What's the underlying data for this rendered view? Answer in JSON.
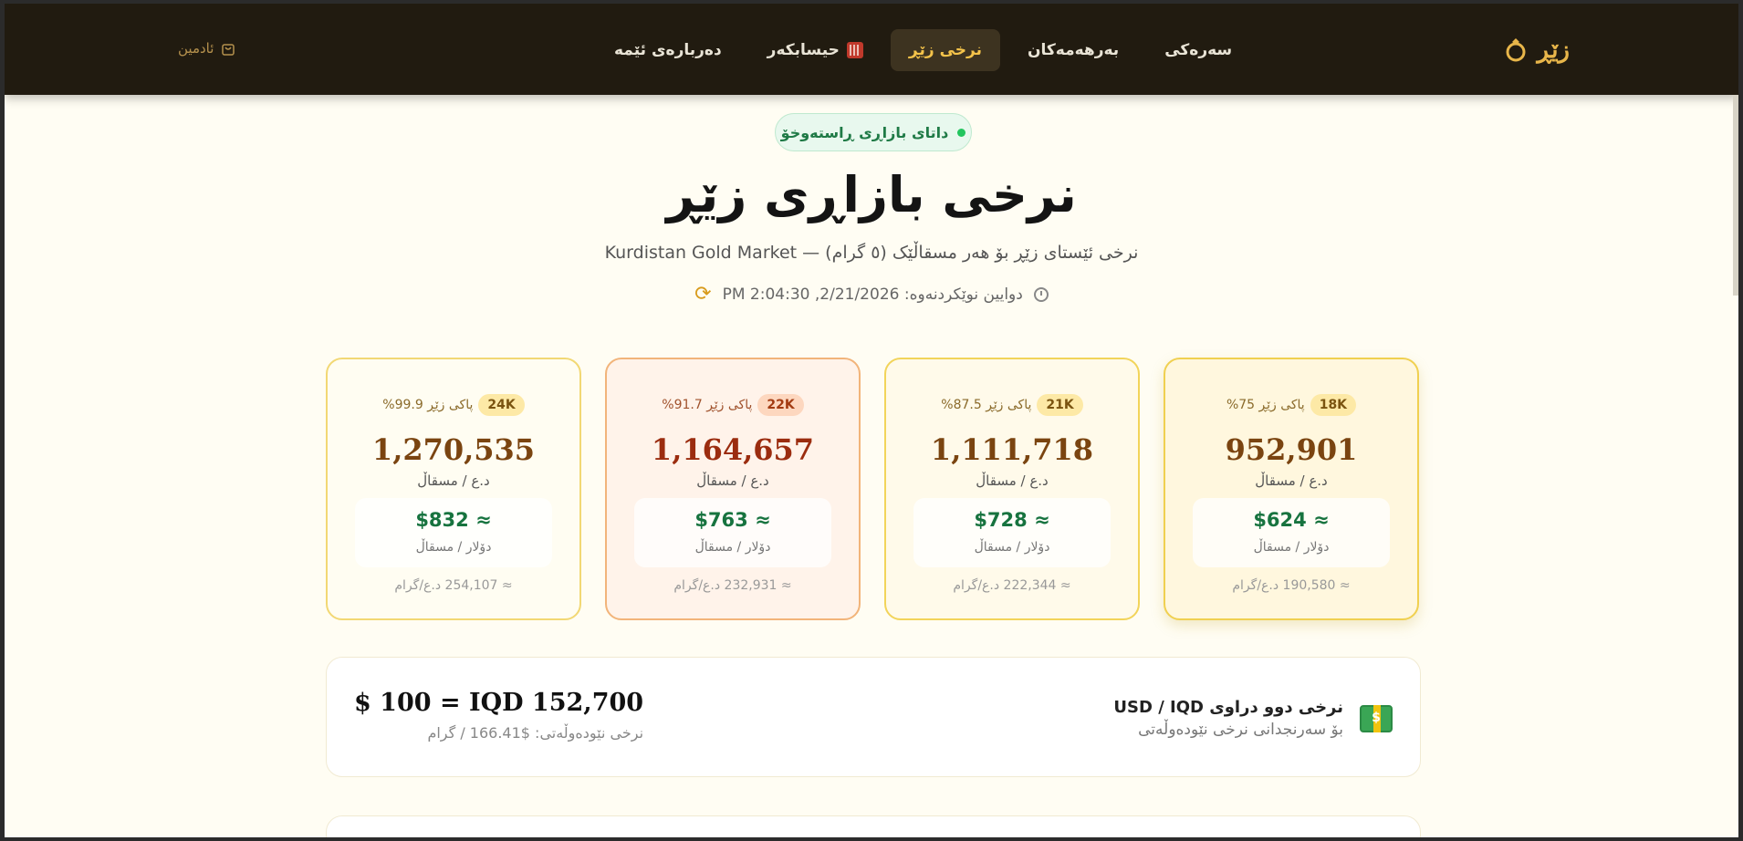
{
  "nav": {
    "brand": "زێڕ",
    "items": [
      {
        "label": "سەرەکی"
      },
      {
        "label": "بەرهەمەکان"
      },
      {
        "label": "نرخی زێڕ"
      },
      {
        "label": "حیسابکەر"
      },
      {
        "label": "دەربارەی ئێمە"
      }
    ],
    "active_index": 2,
    "admin": "ئادمین"
  },
  "hero": {
    "badge": "داتای بازاڕی ڕاستەوخۆ",
    "title": "نرخی بازاڕی زێڕ",
    "subtitle": "نرخی ئێستای زێڕ بۆ هەر مسقاڵێک (٥ گرام) — Kurdistan Gold Market",
    "updated": "دوایین نوێکردنەوە: 2/21/2026, 2:04:30 PM"
  },
  "cards": [
    {
      "karat": "24K",
      "purity": "پاکی زێڕ 99.9%",
      "price": "1,270,535",
      "unit": "د.ع / مسقاڵ",
      "usd": "≈ $832",
      "usd_unit": "دۆلار / مسقاڵ",
      "per_gram": "≈ 254,107 د.ع/گرام"
    },
    {
      "karat": "22K",
      "purity": "پاکی زێڕ 91.7%",
      "price": "1,164,657",
      "unit": "د.ع / مسقاڵ",
      "usd": "≈ $763",
      "usd_unit": "دۆلار / مسقاڵ",
      "per_gram": "≈ 232,931 د.ع/گرام"
    },
    {
      "karat": "21K",
      "purity": "پاکی زێڕ 87.5%",
      "price": "1,111,718",
      "unit": "د.ع / مسقاڵ",
      "usd": "≈ $728",
      "usd_unit": "دۆلار / مسقاڵ",
      "per_gram": "≈ 222,344 د.ع/گرام"
    },
    {
      "karat": "18K",
      "purity": "پاکی زێڕ 75%",
      "price": "952,901",
      "unit": "د.ع / مسقاڵ",
      "usd": "≈ $624",
      "usd_unit": "دۆلار / مسقاڵ",
      "per_gram": "≈ 190,580 د.ع/گرام"
    }
  ],
  "fx": {
    "title": "نرخی دوو دراوی USD / IQD",
    "desc": "بۆ سەرنجدانی نرخی نێودەوڵەتی",
    "rate": "$ 100 = IQD 152,700",
    "intl": "نرخی نێودەوڵەتی: $166.41 / گرام"
  },
  "colors": {
    "nav_bg": "#211b10",
    "accent": "#e8b64a",
    "usd_green": "#17733f"
  }
}
